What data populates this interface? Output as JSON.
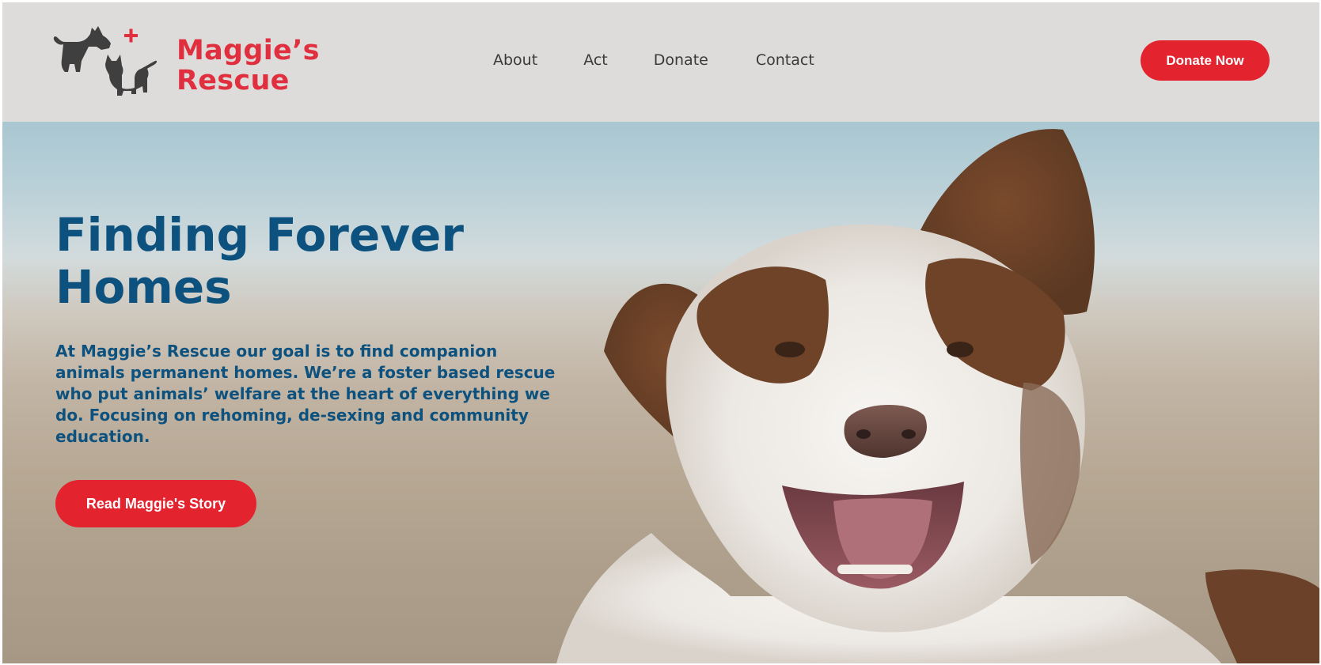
{
  "logo": {
    "line1": "Maggie’s",
    "line2": "Rescue",
    "icon": "dog-cat-cross-icon",
    "brand_color": "#e0303f"
  },
  "nav": {
    "items": [
      {
        "label": "About"
      },
      {
        "label": "Act"
      },
      {
        "label": "Donate"
      },
      {
        "label": "Contact"
      }
    ]
  },
  "header": {
    "donate_button": "Donate Now"
  },
  "hero": {
    "title_line1": "Finding Forever",
    "title_line2": "Homes",
    "description": "At Maggie’s Rescue our goal is to find companion animals permanent homes. We’re a foster based rescue who put animals’ welfare at the heart of everything we do. Focusing on rehoming, de-sexing and community education.",
    "cta_button": "Read Maggie's Story",
    "image": "border-collie-dog-photo",
    "text_color": "#0d527f",
    "accent_color": "#e3232e"
  }
}
